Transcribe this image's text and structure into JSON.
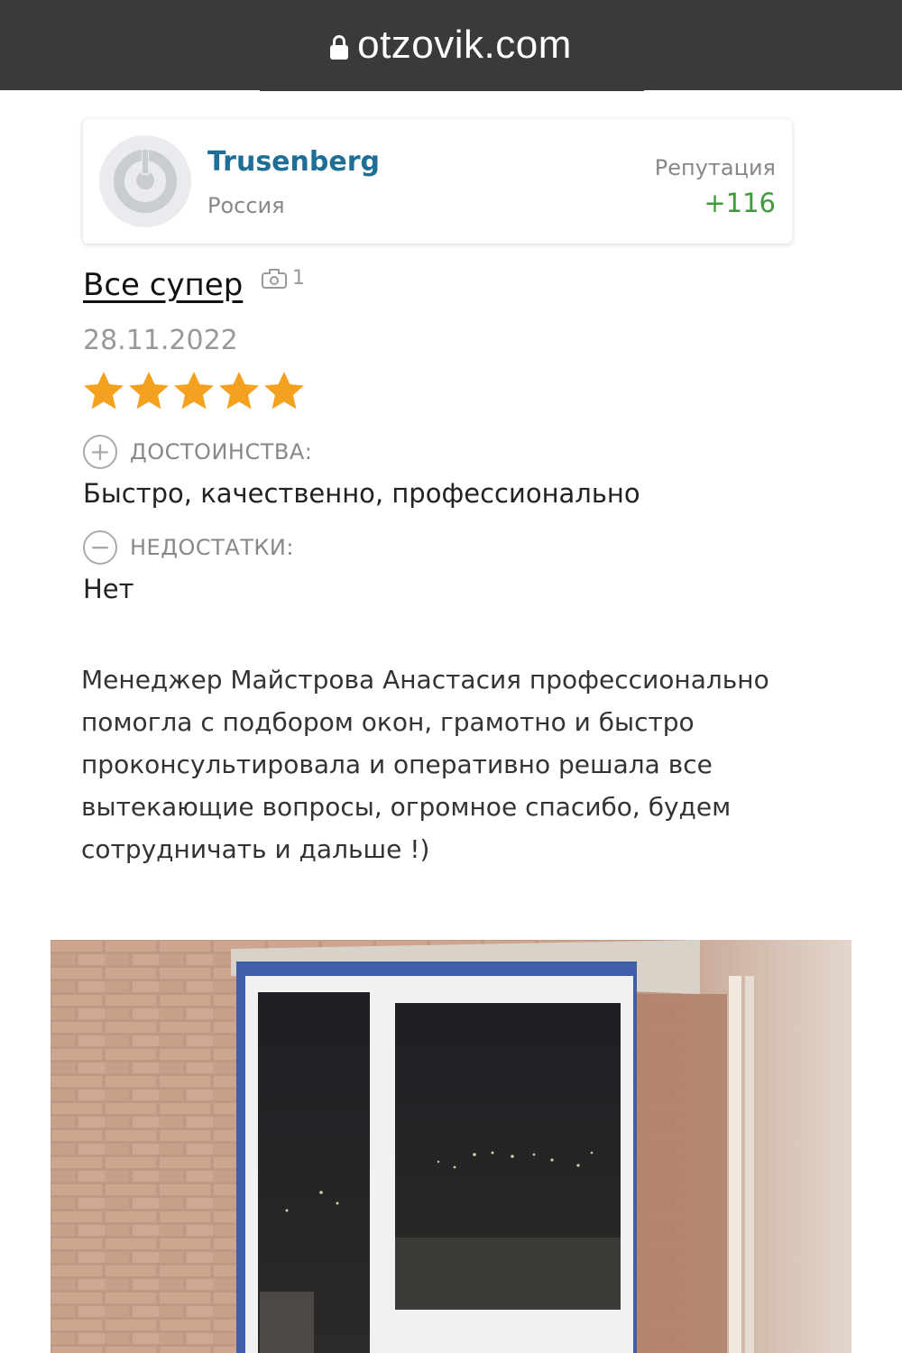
{
  "browser": {
    "url": "otzovik.com"
  },
  "user": {
    "name": "Trusenberg",
    "country": "Россия",
    "reputation_label": "Репутация",
    "reputation_value": "+116"
  },
  "review": {
    "title": "Все супер",
    "photo_count": "1",
    "date": "28.11.2022",
    "rating": 5,
    "rating_max": 5,
    "pros_label": "ДОСТОИНСТВА:",
    "pros_text": "Быстро, качественно, профессионально",
    "cons_label": "НЕДОСТАТКИ:",
    "cons_text": "Нет",
    "body_lines": [
      "Менеджер Майстрова Анастасия профессионально",
      "помогла с подбором окон, грамотно и быстро",
      "проконсультировала и оперативно решала все",
      "вытекающие вопросы, огромное спасибо, будем",
      "сотрудничать и дальше !)"
    ]
  },
  "colors": {
    "url_bar": "#3a3a3c",
    "username": "#1f6e96",
    "reputation": "#3f9a3a",
    "star": "#f4a11f"
  },
  "icons": {
    "lock": "lock-icon",
    "camera": "camera-icon",
    "plus": "plus-circle-icon",
    "minus": "minus-circle-icon",
    "star": "star-icon"
  }
}
